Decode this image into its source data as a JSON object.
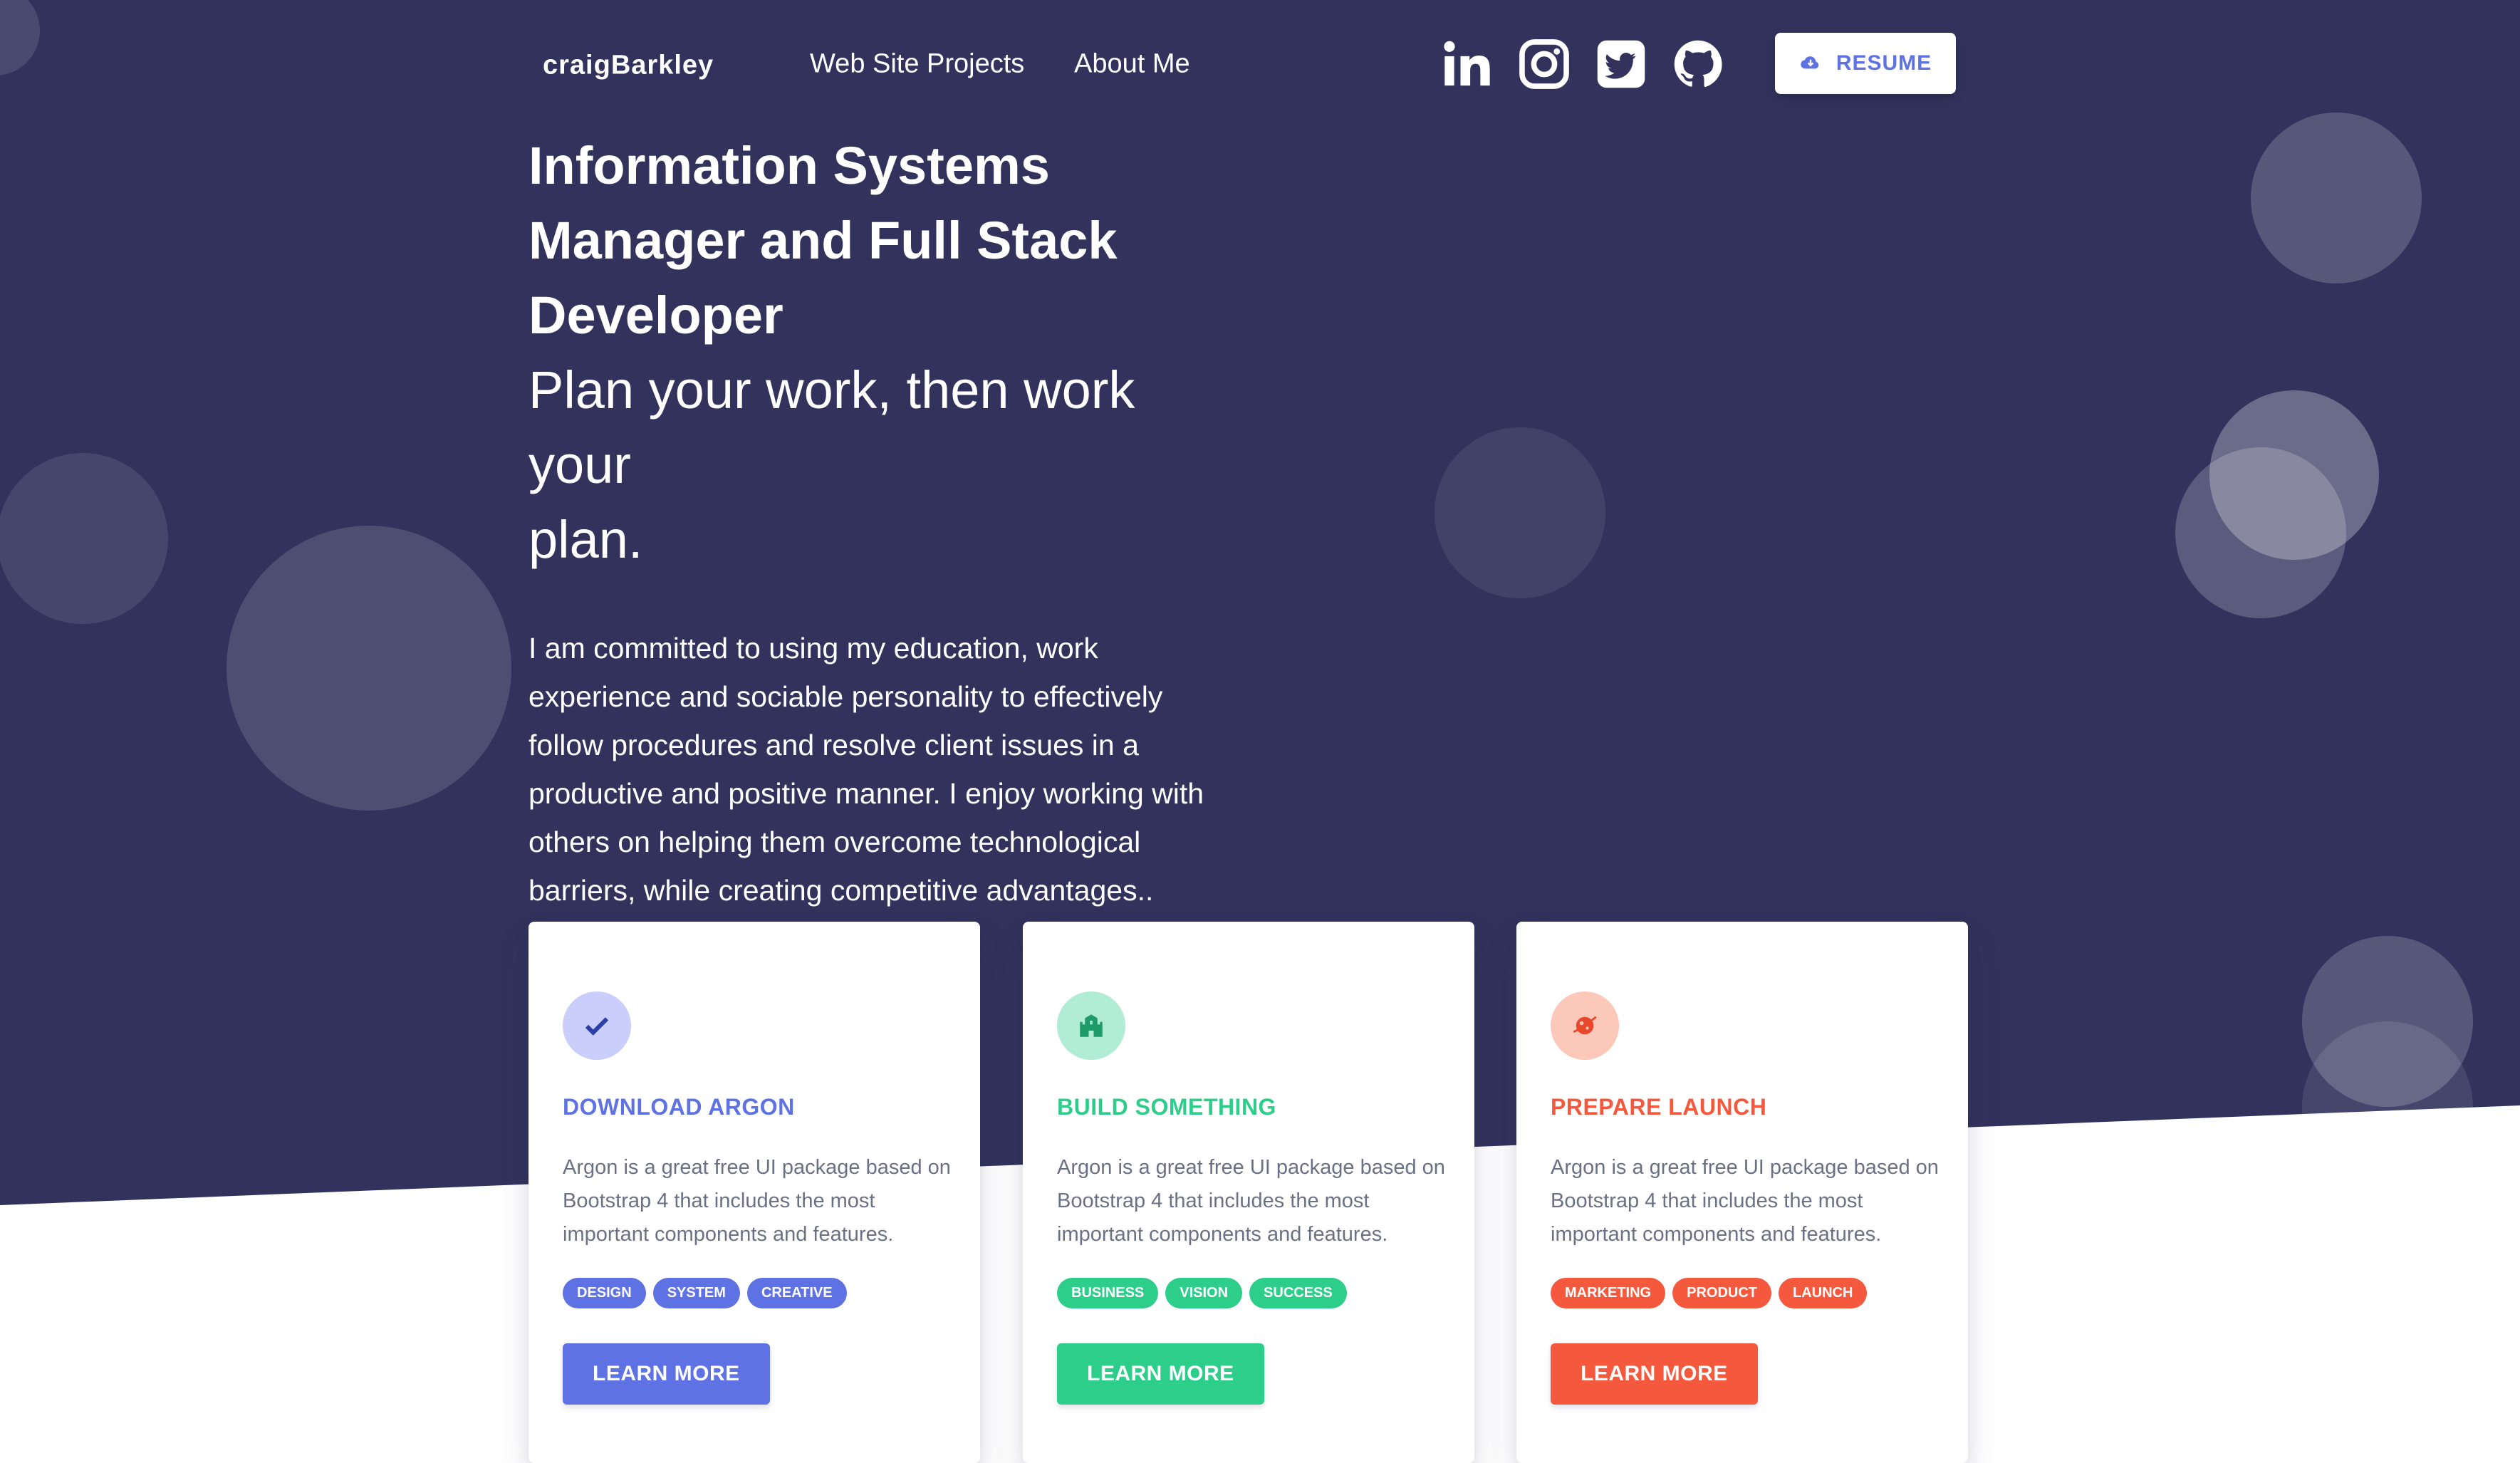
{
  "navbar": {
    "brand": "craigBarkley",
    "links": [
      "Web Site Projects",
      "About Me"
    ],
    "social_icons": [
      "linkedin-icon",
      "instagram-icon",
      "twitter-icon",
      "github-icon"
    ],
    "resume_label": "RESUME",
    "resume_icon": "cloud-download-icon"
  },
  "hero": {
    "title_line1": "Information Systems",
    "title_line2": "Manager and Full Stack",
    "title_line3": "Developer",
    "subtitle_line1": "Plan your work, then work your",
    "subtitle_line2": "plan.",
    "lead": "I am committed to using my education, work experience and sociable personality to effectively follow procedures and resolve client issues in a productive and positive manner. I enjoy working with others on helping them overcome technological barriers, while creating competitive advantages.."
  },
  "cards": [
    {
      "icon": "check-icon",
      "title": "DOWNLOAD ARGON",
      "text": "Argon is a great free UI package based on Bootstrap 4 that includes the most important components and features.",
      "tags": [
        "DESIGN",
        "SYSTEM",
        "CREATIVE"
      ],
      "button": "LEARN MORE",
      "accent": "#5e72e4",
      "icon_bg": "#c9cffa"
    },
    {
      "icon": "castle-icon",
      "title": "BUILD SOMETHING",
      "text": "Argon is a great free UI package based on Bootstrap 4 that includes the most important components and features.",
      "tags": [
        "BUSINESS",
        "VISION",
        "SUCCESS"
      ],
      "button": "LEARN MORE",
      "accent": "#2dce89",
      "icon_bg": "#b0edd4"
    },
    {
      "icon": "planet-icon",
      "title": "PREPARE LAUNCH",
      "text": "Argon is a great free UI package based on Bootstrap 4 that includes the most important components and features.",
      "tags": [
        "MARKETING",
        "PRODUCT",
        "LAUNCH"
      ],
      "button": "LEARN MORE",
      "accent": "#f5365c",
      "icon_bg": "#fbc8b9"
    }
  ],
  "colors": {
    "hero_bg": "#32325d",
    "primary": "#5e72e4",
    "success": "#2dce89",
    "warning": "#f5365c"
  }
}
